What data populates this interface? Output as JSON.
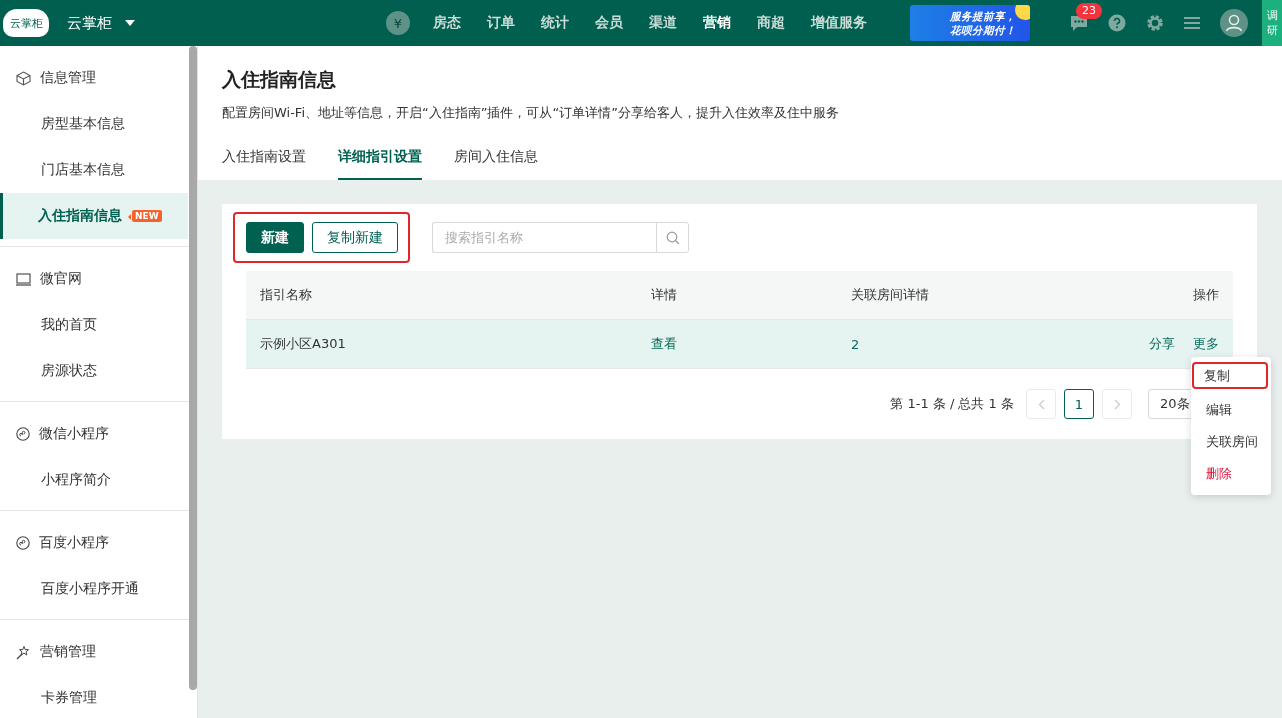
{
  "topbar": {
    "logo": "云掌柜",
    "brand": "云掌柜",
    "currency_symbol": "¥",
    "nav": [
      {
        "label": "房态",
        "selected": false
      },
      {
        "label": "订单",
        "selected": false
      },
      {
        "label": "统计",
        "selected": false
      },
      {
        "label": "会员",
        "selected": false
      },
      {
        "label": "渠道",
        "selected": false
      },
      {
        "label": "营销",
        "selected": true
      },
      {
        "label": "商超",
        "selected": false
      },
      {
        "label": "增值服务",
        "selected": false
      }
    ],
    "promo": [
      "服务提前享，",
      "花呗分期付！"
    ],
    "message_count": "23",
    "survey_tab": "调研"
  },
  "sidebar": {
    "groups": [
      {
        "title": "信息管理",
        "kind": "cube",
        "items": [
          {
            "label": "房型基本信息",
            "selected": false
          },
          {
            "label": "门店基本信息",
            "selected": false
          },
          {
            "label": "入住指南信息",
            "selected": true,
            "badge": "NEW"
          }
        ]
      },
      {
        "title": "微官网",
        "kind": "monitor",
        "items": [
          {
            "label": "我的首页",
            "selected": false
          },
          {
            "label": "房源状态",
            "selected": false
          }
        ]
      },
      {
        "title": "微信小程序",
        "kind": "miniapp",
        "items": [
          {
            "label": "小程序简介",
            "selected": false
          }
        ]
      },
      {
        "title": "百度小程序",
        "kind": "miniapp",
        "items": [
          {
            "label": "百度小程序开通",
            "selected": false
          }
        ]
      },
      {
        "title": "营销管理",
        "kind": "wand",
        "items": [
          {
            "label": "卡券管理",
            "selected": false
          }
        ]
      }
    ]
  },
  "page": {
    "title": "入住指南信息",
    "description": "配置房间Wi-Fi、地址等信息，开启“入住指南”插件，可从“订单详情”分享给客人，提升入住效率及住中服务",
    "tabs": [
      {
        "label": "入住指南设置",
        "selected": false
      },
      {
        "label": "详细指引设置",
        "selected": true
      },
      {
        "label": "房间入住信息",
        "selected": false
      }
    ]
  },
  "toolbar": {
    "highlighted": true,
    "buttons": [
      {
        "label": "新建",
        "kind": "primary"
      },
      {
        "label": "复制新建",
        "kind": "outline"
      }
    ],
    "search": {
      "placeholder": "搜索指引名称"
    }
  },
  "table": {
    "columns": [
      "指引名称",
      "详情",
      "关联房间详情",
      "操作"
    ],
    "rows": [
      {
        "name": "示例小区A301",
        "detail": "查看",
        "rooms": "2",
        "actions": [
          "分享",
          "更多"
        ],
        "selected": true
      }
    ]
  },
  "pagination": {
    "summary": "第 1-1 条 / 总共 1 条",
    "pages": [
      {
        "label": "1",
        "selected": true
      }
    ],
    "prev_disabled": true,
    "next_disabled": true,
    "page_size": "20条"
  },
  "menu": {
    "items": [
      {
        "label": "复制",
        "kind": "normal",
        "highlighted": true
      },
      {
        "label": "编辑",
        "kind": "normal",
        "highlighted": false
      },
      {
        "label": "关联房间",
        "kind": "normal",
        "highlighted": false
      },
      {
        "label": "删除",
        "kind": "danger",
        "highlighted": false
      }
    ]
  }
}
